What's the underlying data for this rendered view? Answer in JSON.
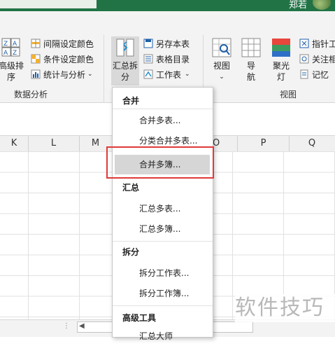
{
  "titlebar": {
    "user_name": "郑若"
  },
  "ribbon": {
    "left_group": {
      "sort_top_glyphs": "Z A A Z",
      "sort_line1": "高级排",
      "sort_line2": "序",
      "interval_color": "间隔设定颜色",
      "condition_color": "条件设定颜色",
      "stats": "统计与分析",
      "group_label": "数据分析"
    },
    "merge_group": {
      "summary_split_line1": "汇总拆",
      "summary_split_line2": "分",
      "save_as": "另存本表",
      "table_toc": "表格目录",
      "worksheet": "工作表"
    },
    "view_group": {
      "view_label": "视图",
      "nav_line1": "导",
      "nav_line2": "航",
      "spotlight_line1": "聚光",
      "spotlight_line2": "灯",
      "pointer": "指针工",
      "comment": "关注相",
      "memo": "记忆",
      "group_label": "视图"
    }
  },
  "columns": [
    "K",
    "L",
    "M",
    "O",
    "P",
    "Q"
  ],
  "menu": {
    "sections": [
      {
        "title": "合并",
        "items": [
          "合并多表...",
          "分类合并多表...",
          "合并多簿..."
        ]
      },
      {
        "title": "汇总",
        "items": [
          "汇总多表...",
          "汇总多簿..."
        ]
      },
      {
        "title": "拆分",
        "items": [
          "拆分工作表...",
          "拆分工作簿..."
        ]
      },
      {
        "title": "高级工具",
        "items": [
          "汇总大师"
        ]
      }
    ],
    "highlighted_item": "合并多簿..."
  },
  "watermark": "软件技巧",
  "colors": {
    "title_green": "#217346",
    "highlight_box": "#e03a3a",
    "menu_highlight": "#d6d6d6"
  }
}
